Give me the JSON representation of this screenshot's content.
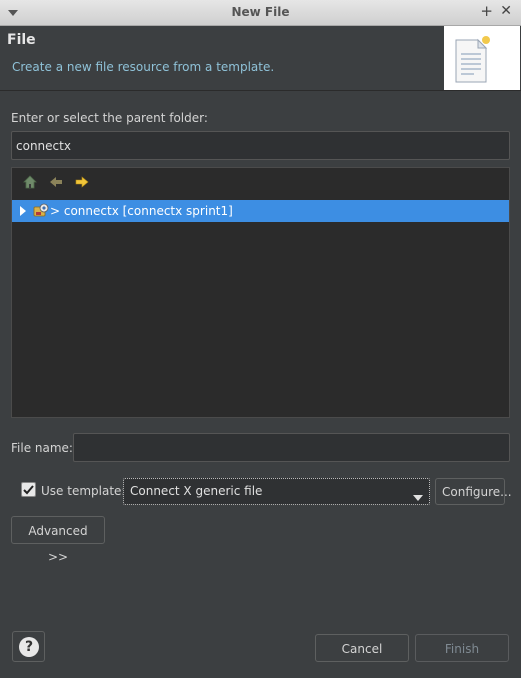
{
  "window": {
    "title": "New File"
  },
  "header": {
    "title": "File",
    "description": "Create a new file resource from a template."
  },
  "parent_folder": {
    "label": "Enter or select the parent folder:",
    "value": "connectx"
  },
  "tree": {
    "items": [
      {
        "label": "> connectx [connectx sprint1]",
        "selected": true,
        "icon": "project-icon"
      }
    ]
  },
  "file_name": {
    "label": "File name:",
    "value": ""
  },
  "template": {
    "checkbox_label": "Use template:",
    "checked": true,
    "selected": "Connect X generic file",
    "configure_label": "Configure..."
  },
  "buttons": {
    "advanced": "Advanced >>",
    "cancel": "Cancel",
    "finish": "Finish",
    "help": "?"
  },
  "colors": {
    "background": "#3c3f41",
    "selection": "#3d8ee3",
    "description_text": "#8fc2d8"
  }
}
